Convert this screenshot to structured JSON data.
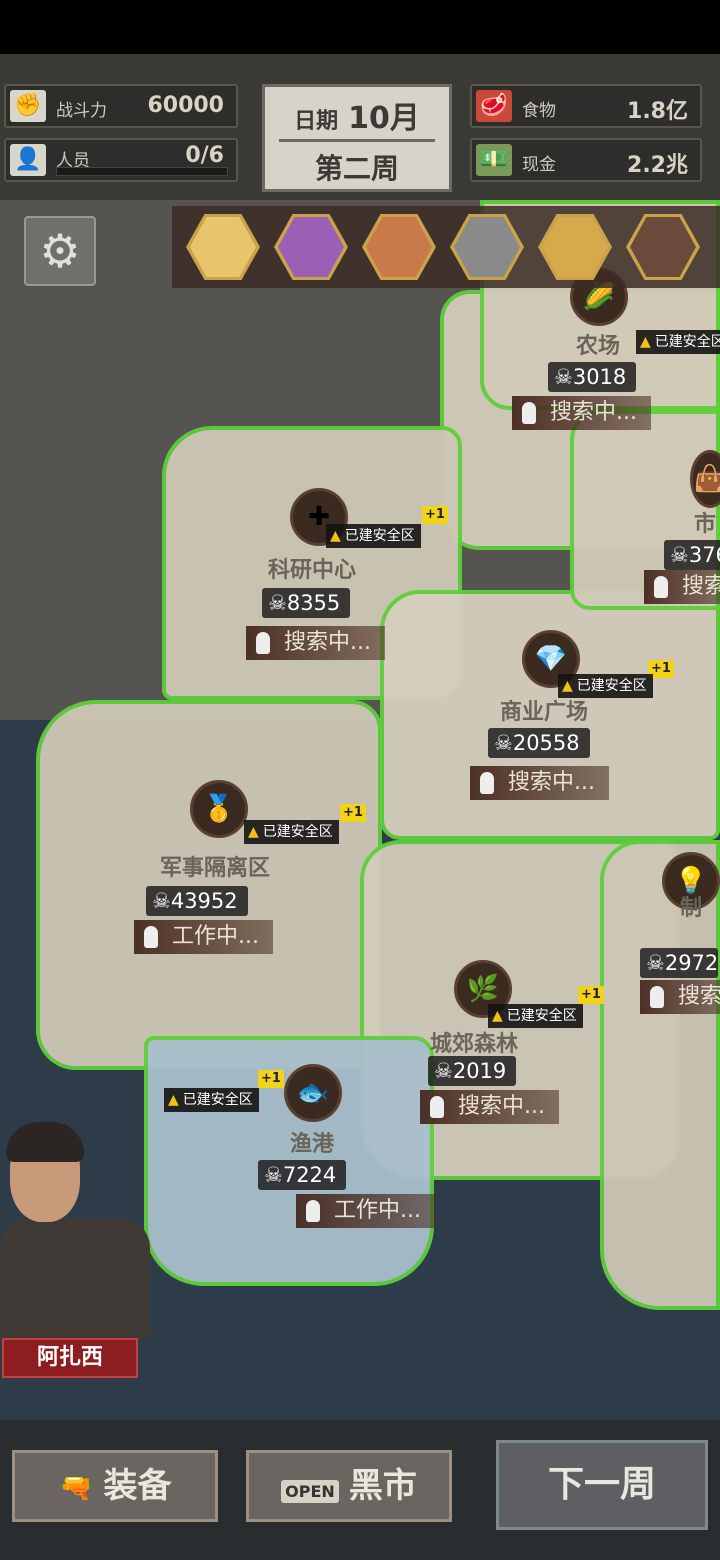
{
  "header": {
    "power": {
      "label": "战斗力",
      "value": "60000",
      "icon": "fist-icon"
    },
    "personnel": {
      "label": "人员",
      "value": "0/6",
      "icon": "person-icon"
    },
    "date": {
      "label": "日期",
      "month": "10月",
      "week": "第二周"
    },
    "food": {
      "label": "食物",
      "value": "1.8亿",
      "icon": "meat-icon"
    },
    "cash": {
      "label": "现金",
      "value": "2.2兆",
      "icon": "cash-icon"
    }
  },
  "portraits": [
    {
      "name": "blonde-girl",
      "color": "#e8c56a"
    },
    {
      "name": "purple-hair-girl",
      "color": "#9c5fb6"
    },
    {
      "name": "glasses-boy",
      "color": "#c97a4a"
    },
    {
      "name": "hat-man",
      "color": "#8a8a8a"
    },
    {
      "name": "blonde-man",
      "color": "#d6a94a"
    },
    {
      "name": "bearded-man",
      "color": "#6a4a3a"
    }
  ],
  "zones": [
    {
      "id": "farm",
      "name": "农场",
      "safe": "已建安全区",
      "threat": "3018",
      "status": "搜索中...",
      "icon": "corn-icon"
    },
    {
      "id": "research",
      "name": "科研中心",
      "safe": "已建安全区",
      "plus": "+1",
      "threat": "8355",
      "status": "搜索中...",
      "icon": "medkit-icon"
    },
    {
      "id": "mall",
      "name": "商业广场",
      "safe": "已建安全区",
      "plus": "+1",
      "threat": "20558",
      "status": "搜索中...",
      "icon": "necklace-icon"
    },
    {
      "id": "military",
      "name": "军事隔离区",
      "safe": "已建安全区",
      "plus": "+1",
      "threat": "43952",
      "status": "工作中...",
      "icon": "gold-icon"
    },
    {
      "id": "forest",
      "name": "城郊森林",
      "safe": "已建安全区",
      "plus": "+1",
      "threat": "2019",
      "status": "搜索中...",
      "icon": "leaf-icon"
    },
    {
      "id": "harbor",
      "name": "渔港",
      "safe": "已建安全区",
      "plus": "+1",
      "threat": "7224",
      "status": "工作中...",
      "icon": "fish-icon"
    },
    {
      "id": "east-top",
      "name": "市",
      "threat": "376",
      "status": "搜索",
      "icon": "bag-icon"
    },
    {
      "id": "east-mid",
      "name": "制",
      "threat": "2972",
      "status": "搜索",
      "icon": "lamp-icon"
    }
  ],
  "leader": {
    "name": "阿扎西"
  },
  "buttons": {
    "equipment": "装备",
    "black_market": "黑市",
    "black_market_sign": "OPEN",
    "next_week": "下一周"
  }
}
